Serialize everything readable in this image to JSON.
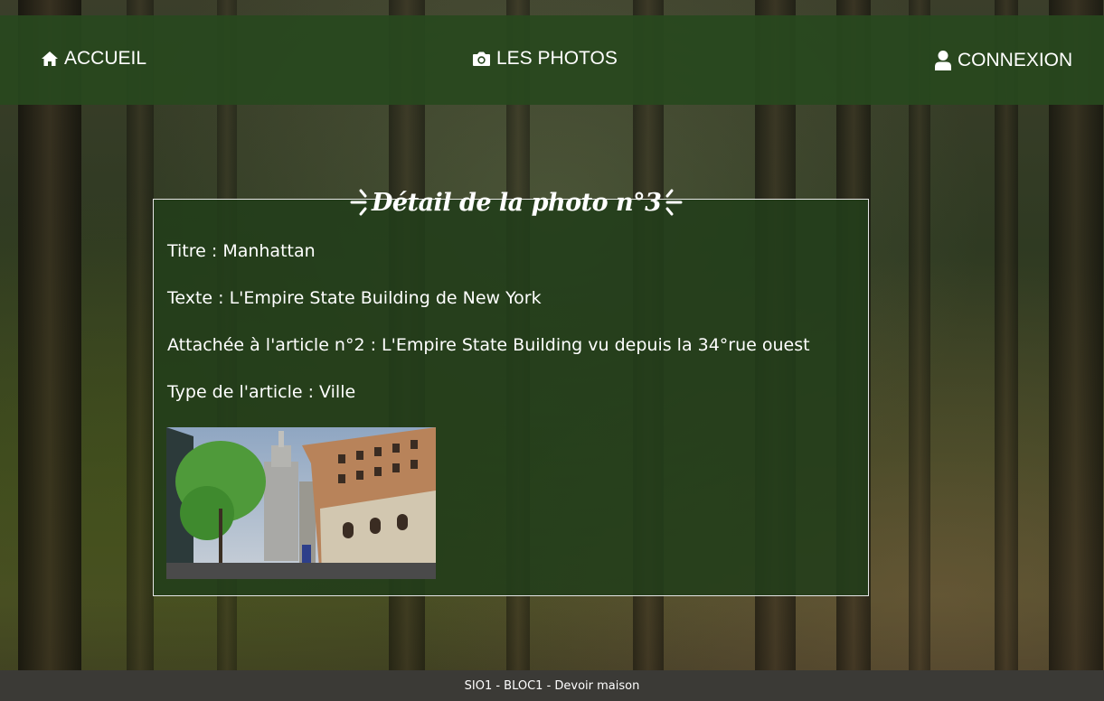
{
  "nav": {
    "home": {
      "label": "ACCUEIL",
      "icon": "home-icon"
    },
    "photos": {
      "label": "LES PHOTOS",
      "icon": "camera-icon"
    },
    "login": {
      "label": "CONNEXION",
      "icon": "user-icon"
    }
  },
  "detail": {
    "title": "Détail de la photo n°3",
    "lines": {
      "titre": "Titre : Manhattan",
      "texte": "Texte : L'Empire State Building de New York",
      "article": "Attachée à l'article n°2 : L'Empire State Building vu depuis la 34°rue ouest",
      "type": "Type de l'article : Ville"
    },
    "photo": {
      "alt": "Manhattan"
    }
  },
  "footer": {
    "text": "SIO1 - BLOC1 - Devoir maison"
  },
  "colors": {
    "navbar": "#284820",
    "panel": "#223e1a",
    "footer": "#3b3a36",
    "text": "#ffffff"
  }
}
